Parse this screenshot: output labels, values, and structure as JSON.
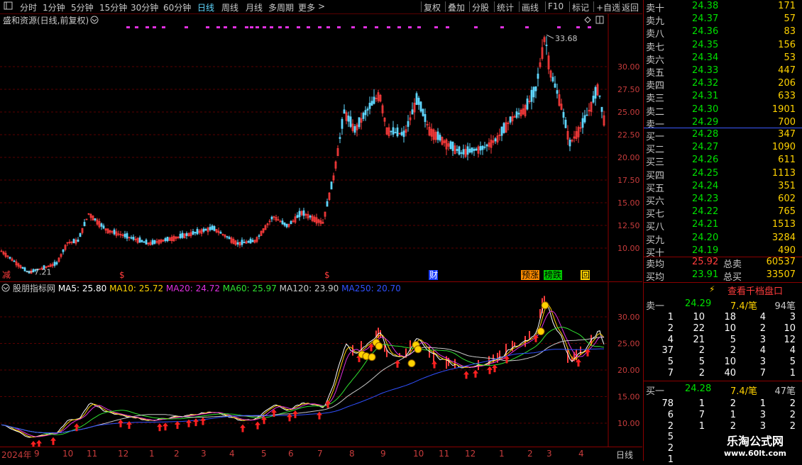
{
  "toolbar": {
    "periods": [
      "分时",
      "1分钟",
      "5分钟",
      "15分钟",
      "30分钟",
      "60分钟",
      "日线",
      "周线",
      "月线",
      "多周期",
      "更多"
    ],
    "active": "日线",
    "more_arrow": ">",
    "actions": [
      "复权",
      "叠加",
      "分股",
      "统计",
      "画线",
      "F10",
      "标记",
      "+自选",
      "返回"
    ]
  },
  "main": {
    "title": "盛和资源(日线,前复权)",
    "high_label": "33.68",
    "low_label": "7.21",
    "y_ticks": [
      "30.00",
      "27.50",
      "25.00",
      "22.50",
      "20.00",
      "17.50",
      "15.00",
      "12.50",
      "10.00"
    ],
    "events": [
      {
        "text": "减",
        "color": "#ff3c3c",
        "bg": ""
      },
      {
        "text": "$",
        "color": "#ff3c3c",
        "bg": ""
      },
      {
        "text": "$",
        "color": "#ff3c3c",
        "bg": ""
      },
      {
        "text": "财",
        "color": "#ffffff",
        "bg": "#1a3cff"
      },
      {
        "text": "预涨",
        "color": "#000000",
        "bg": "#ff8c00"
      },
      {
        "text": "榜跌",
        "color": "#000000",
        "bg": "#00c800"
      },
      {
        "text": "回",
        "color": "#000000",
        "bg": "#ffd200"
      }
    ]
  },
  "indicator": {
    "name": "股朋指标网",
    "mas": [
      {
        "label": "MA5: 25.80",
        "color": "#ffffff"
      },
      {
        "label": "MA10: 25.72",
        "color": "#ffd200"
      },
      {
        "label": "MA20: 24.72",
        "color": "#e030e0"
      },
      {
        "label": "MA60: 25.97",
        "color": "#30e030"
      },
      {
        "label": "MA120: 23.90",
        "color": "#c8c8c8"
      },
      {
        "label": "MA250: 20.70",
        "color": "#3050ff"
      }
    ],
    "y_ticks": [
      "30.00",
      "25.00",
      "20.00",
      "15.00",
      "10.00"
    ]
  },
  "xaxis": {
    "labels": [
      "2024年",
      "9",
      "10",
      "11",
      "12",
      "1",
      "2",
      "3",
      "4",
      "5",
      "6",
      "7",
      "8",
      "9",
      "10",
      "11",
      "12",
      "1",
      "2",
      "3",
      "4"
    ],
    "period": "日线"
  },
  "book": {
    "sells": [
      {
        "label": "卖十",
        "price": "24.38",
        "vol": "171"
      },
      {
        "label": "卖九",
        "price": "24.37",
        "vol": "57"
      },
      {
        "label": "卖八",
        "price": "24.36",
        "vol": "83"
      },
      {
        "label": "卖七",
        "price": "24.35",
        "vol": "156"
      },
      {
        "label": "卖六",
        "price": "24.34",
        "vol": "53"
      },
      {
        "label": "卖五",
        "price": "24.33",
        "vol": "447"
      },
      {
        "label": "卖四",
        "price": "24.32",
        "vol": "206"
      },
      {
        "label": "卖三",
        "price": "24.31",
        "vol": "633"
      },
      {
        "label": "卖二",
        "price": "24.30",
        "vol": "1901"
      },
      {
        "label": "卖一",
        "price": "24.29",
        "vol": "700"
      }
    ],
    "buys": [
      {
        "label": "买一",
        "price": "24.28",
        "vol": "347"
      },
      {
        "label": "买二",
        "price": "24.27",
        "vol": "1090"
      },
      {
        "label": "买三",
        "price": "24.26",
        "vol": "611"
      },
      {
        "label": "买四",
        "price": "24.25",
        "vol": "1113"
      },
      {
        "label": "买五",
        "price": "24.24",
        "vol": "351"
      },
      {
        "label": "买六",
        "price": "24.23",
        "vol": "602"
      },
      {
        "label": "买七",
        "price": "24.22",
        "vol": "765"
      },
      {
        "label": "买八",
        "price": "24.21",
        "vol": "1513"
      },
      {
        "label": "买九",
        "price": "24.20",
        "vol": "3284"
      },
      {
        "label": "买十",
        "price": "24.19",
        "vol": "490"
      }
    ],
    "avg_sell_label": "卖均",
    "avg_sell": "25.92",
    "total_sell_label": "总卖",
    "total_sell": "60537",
    "avg_buy_label": "买均",
    "avg_buy": "23.91",
    "total_buy_label": "总买",
    "total_buy": "33507",
    "view_label": "查看千档盘口",
    "sell1_label": "卖一",
    "sell1_price": "24.29",
    "sell1_per": "7.4/笔",
    "sell1_count": "94笔",
    "sell_queue": [
      [
        "1",
        "10",
        "18",
        "4",
        "3"
      ],
      [
        "2",
        "22",
        "10",
        "2",
        "10"
      ],
      [
        "4",
        "21",
        "5",
        "3",
        "12"
      ],
      [
        "37",
        "2",
        "2",
        "4",
        "4"
      ],
      [
        "5",
        "5",
        "10",
        "3",
        "5"
      ],
      [
        "7",
        "2",
        "40",
        "7",
        "1"
      ]
    ],
    "buy1_label": "买一",
    "buy1_price": "24.28",
    "buy1_per": "7.4/笔",
    "buy1_count": "47笔",
    "buy_queue": [
      [
        "78",
        "1",
        "2",
        "1",
        "2"
      ],
      [
        "6",
        "7",
        "1",
        "3",
        "2"
      ],
      [
        "2",
        "1",
        "2",
        "3",
        "2"
      ],
      [
        "5",
        "",
        "",
        "",
        ""
      ],
      [
        "2",
        "",
        "",
        "",
        ""
      ],
      [
        "1",
        "",
        "",
        "",
        ""
      ]
    ],
    "watermark": "乐淘公式网",
    "watermark_url": "www.60lt.com"
  }
}
